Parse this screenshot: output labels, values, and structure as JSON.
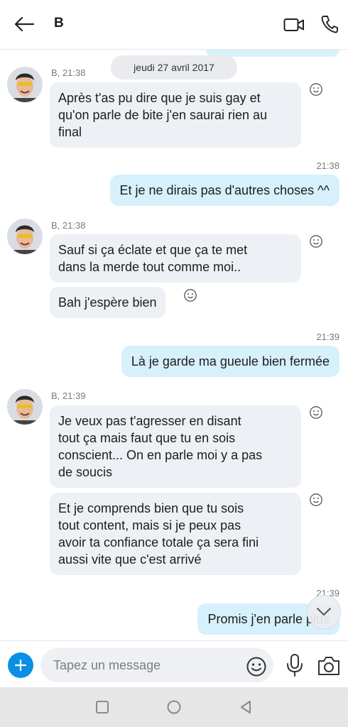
{
  "header": {
    "title": "B",
    "back_icon": "arrow-left-icon",
    "video_icon": "video-camera-icon",
    "call_icon": "phone-icon"
  },
  "date_separator": "jeudi 27 avril 2017",
  "messages": [
    {
      "sender": "B",
      "meta": "B, 21:38",
      "text_lines": [
        "Après t'as pu dire que je suis gay et",
        "qu'on parle de bite j'en saurai rien au",
        "final"
      ]
    },
    {
      "time": "21:38",
      "text": "Et je ne dirais pas d'autres choses ^^"
    },
    {
      "meta": "B, 21:38",
      "text_lines": [
        "Sauf si ça éclate et que ça te met",
        "dans la merde tout comme moi.."
      ]
    },
    {
      "text": "Bah j'espère bien"
    },
    {
      "time": "21:39",
      "text": "Là je garde ma gueule bien fermée"
    },
    {
      "meta": "B, 21:39",
      "text_lines": [
        "Je veux pas t'agresser en disant",
        "tout ça mais faut que tu en sois",
        "conscient... On en parle moi y a pas",
        "de soucis"
      ]
    },
    {
      "text_lines": [
        "Et je comprends bien que tu sois",
        "tout content, mais si je peux pas",
        "avoir ta confiance totale ça sera fini",
        "aussi vite que c'est arrivé"
      ]
    },
    {
      "time": "21:39",
      "text": "Promis j'en parle plus"
    }
  ],
  "composer": {
    "placeholder": "Tapez un message"
  },
  "colors": {
    "accent": "#0b8fe5",
    "incoming_bubble": "#edf0f4",
    "outgoing_bubble": "#d6f0fc"
  }
}
